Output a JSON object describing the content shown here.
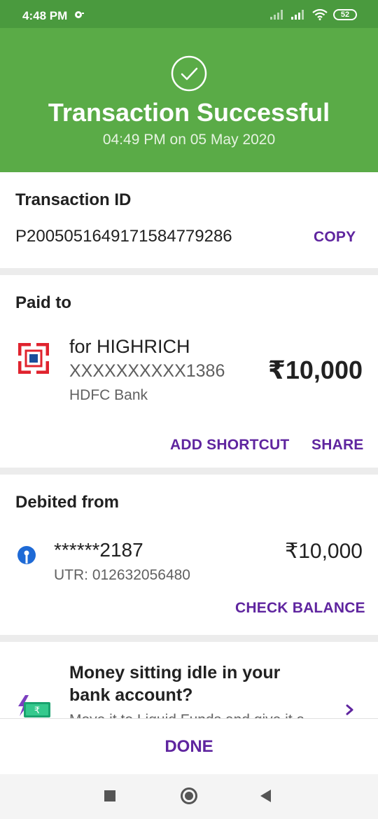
{
  "status_bar": {
    "time": "4:48 PM",
    "battery": "52"
  },
  "header": {
    "title": "Transaction Successful",
    "subtitle": "04:49 PM on 05 May 2020"
  },
  "transaction": {
    "label": "Transaction ID",
    "id": "P2005051649171584779286",
    "copy_label": "COPY"
  },
  "paid_to": {
    "label": "Paid to",
    "name": "for HIGHRICH",
    "account": "XXXXXXXXXX1386",
    "bank": "HDFC Bank",
    "amount": "₹10,000",
    "add_shortcut_label": "ADD SHORTCUT",
    "share_label": "SHARE"
  },
  "debited_from": {
    "label": "Debited from",
    "account": "******2187",
    "utr": "UTR: 012632056480",
    "amount": "₹10,000",
    "check_balance_label": "CHECK BALANCE"
  },
  "promo": {
    "title": "Money sitting idle in your bank account?",
    "subtitle": "Move it to Liquid Funds and give it a"
  },
  "footer": {
    "done_label": "DONE"
  },
  "colors": {
    "header_green": "#5aab47",
    "status_green": "#4a9a3e",
    "accent_purple": "#5f259f"
  }
}
